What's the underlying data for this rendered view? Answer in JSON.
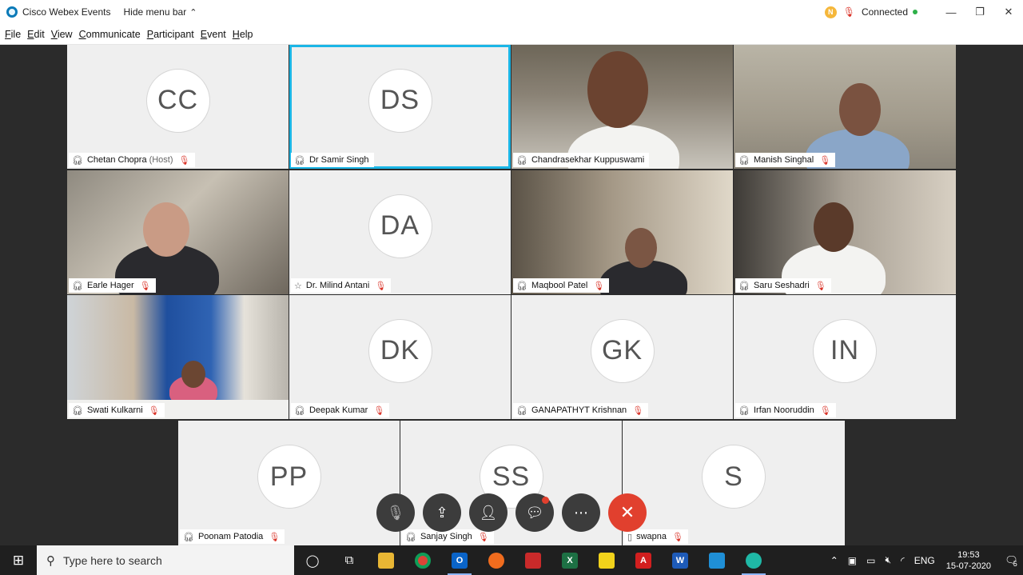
{
  "titlebar": {
    "app_title": "Cisco Webex Events",
    "hide_menu": "Hide menu bar",
    "status_letter": "N",
    "connected": "Connected"
  },
  "menu": [
    "File",
    "Edit",
    "View",
    "Communicate",
    "Participant",
    "Event",
    "Help"
  ],
  "tiles": [
    {
      "name": "Chetan Chopra",
      "suffix": "(Host)",
      "initials": "CC",
      "video": false
    },
    {
      "name": "Dr Samir Singh",
      "suffix": "",
      "initials": "DS",
      "video": false,
      "active": true
    },
    {
      "name": "Chandrasekhar Kuppuswami",
      "suffix": "",
      "initials": "",
      "video": true
    },
    {
      "name": "Manish Singhal",
      "suffix": "",
      "initials": "",
      "video": true
    },
    {
      "name": "Earle Hager",
      "suffix": "",
      "initials": "",
      "video": true
    },
    {
      "name": "Dr. Milind Antani",
      "suffix": "",
      "initials": "DA",
      "video": false
    },
    {
      "name": "Maqbool Patel",
      "suffix": "",
      "initials": "",
      "video": true
    },
    {
      "name": "Saru Seshadri",
      "suffix": "",
      "initials": "",
      "video": true
    },
    {
      "name": "Swati Kulkarni",
      "suffix": "",
      "initials": "",
      "video": true
    },
    {
      "name": "Deepak Kumar",
      "suffix": "",
      "initials": "DK",
      "video": false
    },
    {
      "name": "GANAPATHYT Krishnan",
      "suffix": "",
      "initials": "GK",
      "video": false
    },
    {
      "name": "Irfan Nooruddin",
      "suffix": "",
      "initials": "IN",
      "video": false
    },
    {
      "name": "Poonam Patodia",
      "suffix": "",
      "initials": "PP",
      "video": false
    },
    {
      "name": "Sanjay Singh",
      "suffix": "",
      "initials": "SS",
      "video": false
    },
    {
      "name": "swapna",
      "suffix": "",
      "initials": "S",
      "video": false
    }
  ],
  "controls": {
    "mute_icon": "mic-off-icon",
    "share_icon": "share-icon",
    "participants_icon": "participants-icon",
    "chat_icon": "chat-icon",
    "more_icon": "more-icon",
    "end_icon": "close-icon"
  },
  "taskbar": {
    "search_placeholder": "Type here to search",
    "language": "ENG",
    "time": "19:53",
    "date": "15-07-2020",
    "notif_count": "5"
  },
  "colors": {
    "active_border": "#1bb6e6",
    "end_call": "#e1402e",
    "muted": "#d93025"
  }
}
